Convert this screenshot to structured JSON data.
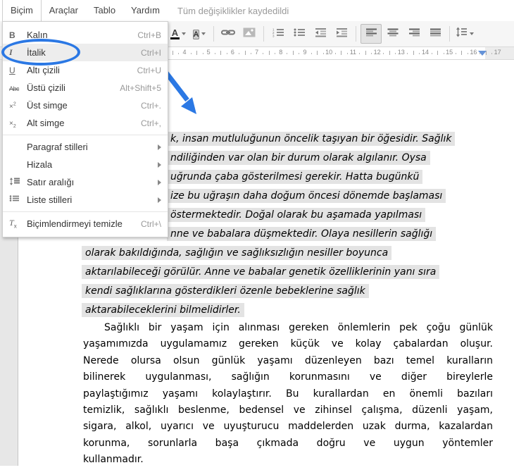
{
  "menubar": {
    "menus": [
      {
        "label": "Biçim",
        "open": true
      },
      {
        "label": "Araçlar",
        "open": false
      },
      {
        "label": "Tablo",
        "open": false
      },
      {
        "label": "Yardım",
        "open": false
      }
    ],
    "status": "Tüm değişiklikler kaydedildi"
  },
  "format_menu": {
    "items": [
      {
        "icon": "bold-icon",
        "label": "Kalın",
        "shortcut": "Ctrl+B",
        "highlighted": false,
        "submenu": false,
        "divider_after": false
      },
      {
        "icon": "italic-icon",
        "label": "İtalik",
        "shortcut": "Ctrl+I",
        "highlighted": true,
        "circled": true,
        "submenu": false,
        "divider_after": false
      },
      {
        "icon": "underline-icon",
        "label": "Altı çizili",
        "shortcut": "Ctrl+U",
        "highlighted": false,
        "submenu": false,
        "divider_after": false
      },
      {
        "icon": "strikethrough-icon",
        "label": "Üstü çizili",
        "shortcut": "Alt+Shift+5",
        "highlighted": false,
        "submenu": false,
        "divider_after": false
      },
      {
        "icon": "superscript-icon",
        "label": "Üst simge",
        "shortcut": "Ctrl+.",
        "highlighted": false,
        "submenu": false,
        "divider_after": false
      },
      {
        "icon": "subscript-icon",
        "label": "Alt simge",
        "shortcut": "Ctrl+,",
        "highlighted": false,
        "submenu": false,
        "divider_after": true
      },
      {
        "icon": "",
        "label": "Paragraf stilleri",
        "shortcut": "",
        "highlighted": false,
        "submenu": true,
        "divider_after": false
      },
      {
        "icon": "",
        "label": "Hizala",
        "shortcut": "",
        "highlighted": false,
        "submenu": true,
        "divider_after": false
      },
      {
        "icon": "line-spacing-icon",
        "label": "Satır aralığı",
        "shortcut": "",
        "highlighted": false,
        "submenu": true,
        "divider_after": false
      },
      {
        "icon": "list-styles-icon",
        "label": "Liste stilleri",
        "shortcut": "",
        "highlighted": false,
        "submenu": true,
        "divider_after": true
      },
      {
        "icon": "clear-formatting-icon",
        "label": "Biçimlendirmeyi temizle",
        "shortcut": "Ctrl+\\",
        "highlighted": false,
        "submenu": false,
        "divider_after": false
      }
    ]
  },
  "toolbar": {
    "buttons": [
      {
        "name": "text-color-button",
        "icon": "text-color-icon",
        "dropdown": true
      },
      {
        "name": "highlight-color-button",
        "icon": "highlight-color-icon",
        "dropdown": true
      },
      {
        "sep": true
      },
      {
        "name": "insert-link-button",
        "icon": "link-icon"
      },
      {
        "name": "insert-image-button",
        "icon": "image-icon"
      },
      {
        "sep": true
      },
      {
        "name": "numbered-list-button",
        "icon": "numbered-list-icon"
      },
      {
        "name": "bulleted-list-button",
        "icon": "bulleted-list-icon"
      },
      {
        "name": "decrease-indent-button",
        "icon": "outdent-icon"
      },
      {
        "name": "increase-indent-button",
        "icon": "indent-icon"
      },
      {
        "sep": true
      },
      {
        "name": "align-left-button",
        "icon": "align-left-icon",
        "active": true
      },
      {
        "name": "align-center-button",
        "icon": "align-center-icon"
      },
      {
        "name": "align-right-button",
        "icon": "align-right-icon"
      },
      {
        "name": "align-justify-button",
        "icon": "align-justify-icon"
      },
      {
        "sep": true
      },
      {
        "name": "line-spacing-button",
        "icon": "line-spacing-toolbar-icon",
        "dropdown": true
      }
    ]
  },
  "ruler": {
    "numbers": [
      4,
      5,
      6,
      7,
      8,
      9,
      10,
      11,
      12,
      13,
      14,
      15,
      16,
      17
    ]
  },
  "document": {
    "selected_paragraph": {
      "style": "italic selected",
      "lines": [
        {
          "text": "k, insan mutluluğunun öncelik taşıyan bir öğesidir. Sağlık",
          "partial": true
        },
        {
          "text": "ndiliğinden var olan bir durum olarak algılanır. Oysa",
          "partial": true
        },
        {
          "text": "uğrunda çaba gösterilmesi gerekir. Hatta bugünkü",
          "partial": true
        },
        {
          "text": "ize bu uğraşın daha doğum öncesi dönemde başlaması",
          "partial": true
        },
        {
          "text": "östermektedir. Doğal olarak bu aşamada yapılması",
          "partial": true
        },
        {
          "text": "nne ve babalara düşmektedir. Olaya nesillerin sağlığı",
          "partial": true
        },
        {
          "text": "olarak bakıldığında, sağlığın ve sağlıksızlığın nesiller boyunca",
          "partial": false
        },
        {
          "text": "aktarılabileceği görülür. Anne ve babalar genetik özelliklerinin yanı sıra",
          "partial": false
        },
        {
          "text": "kendi sağlıklarına gösterdikleri özenle bebeklerine sağlık",
          "partial": false
        },
        {
          "text": "aktarabileceklerini bilmelidirler.",
          "partial": false
        }
      ]
    },
    "paragraph": {
      "lines": [
        "Sağlıklı bir yaşam için alınması gereken önlemlerin pek çoğu günlük",
        "yaşamımızda  uygulamamız gereken küçük ve kolay çabalardan oluşur.",
        "Nerede olursa olsun günlük yaşamı düzenleyen bazı temel kuralların",
        "bilinerek uygulanması, sağlığın korunmasını ve diğer bireylerle",
        "paylaştığımız yaşamı kolaylaştırır. Bu kurallardan en önemli bazıları",
        "temizlik, sağlıklı beslenme, bedensel ve zihinsel çalışma, düzenli yaşam,",
        "sigara, alkol, uyarıcı ve uyuşturucu maddelerden uzak durma, kazalardan",
        "korunma, sorunlarla başa çıkmada doğru ve uygun yöntemler",
        "kullanmadır."
      ]
    }
  },
  "colors": {
    "annotation_blue": "#2b78e4",
    "selection_gray": "#e3e3e3",
    "menu_highlight": "#ededed"
  }
}
